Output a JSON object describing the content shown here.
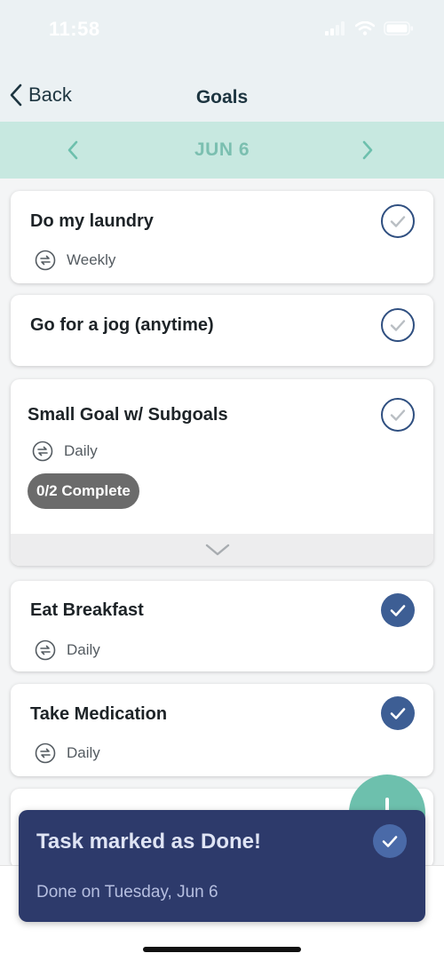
{
  "status_bar": {
    "time": "11:58"
  },
  "nav": {
    "back_label": "Back",
    "title": "Goals"
  },
  "date_bar": {
    "date": "JUN 6"
  },
  "goals": [
    {
      "title": "Do my laundry",
      "repeat": "Weekly",
      "done": false
    },
    {
      "title": "Go for a jog (anytime)",
      "done": false
    },
    {
      "title": "Small Goal w/ Subgoals",
      "repeat": "Daily",
      "progress": "0/2 Complete",
      "done": false
    },
    {
      "title": "Eat Breakfast",
      "repeat": "Daily",
      "done": true
    },
    {
      "title": "Take Medication",
      "repeat": "Daily",
      "done": true
    }
  ],
  "toast": {
    "title": "Task marked as Done!",
    "subtitle": "Done on Tuesday, Jun 6"
  },
  "colors": {
    "accent_teal": "#6dc0ad",
    "date_bar_bg": "#c7e8e0",
    "check_navy": "#3d5e94",
    "toast_bg": "#2d3a6b"
  }
}
